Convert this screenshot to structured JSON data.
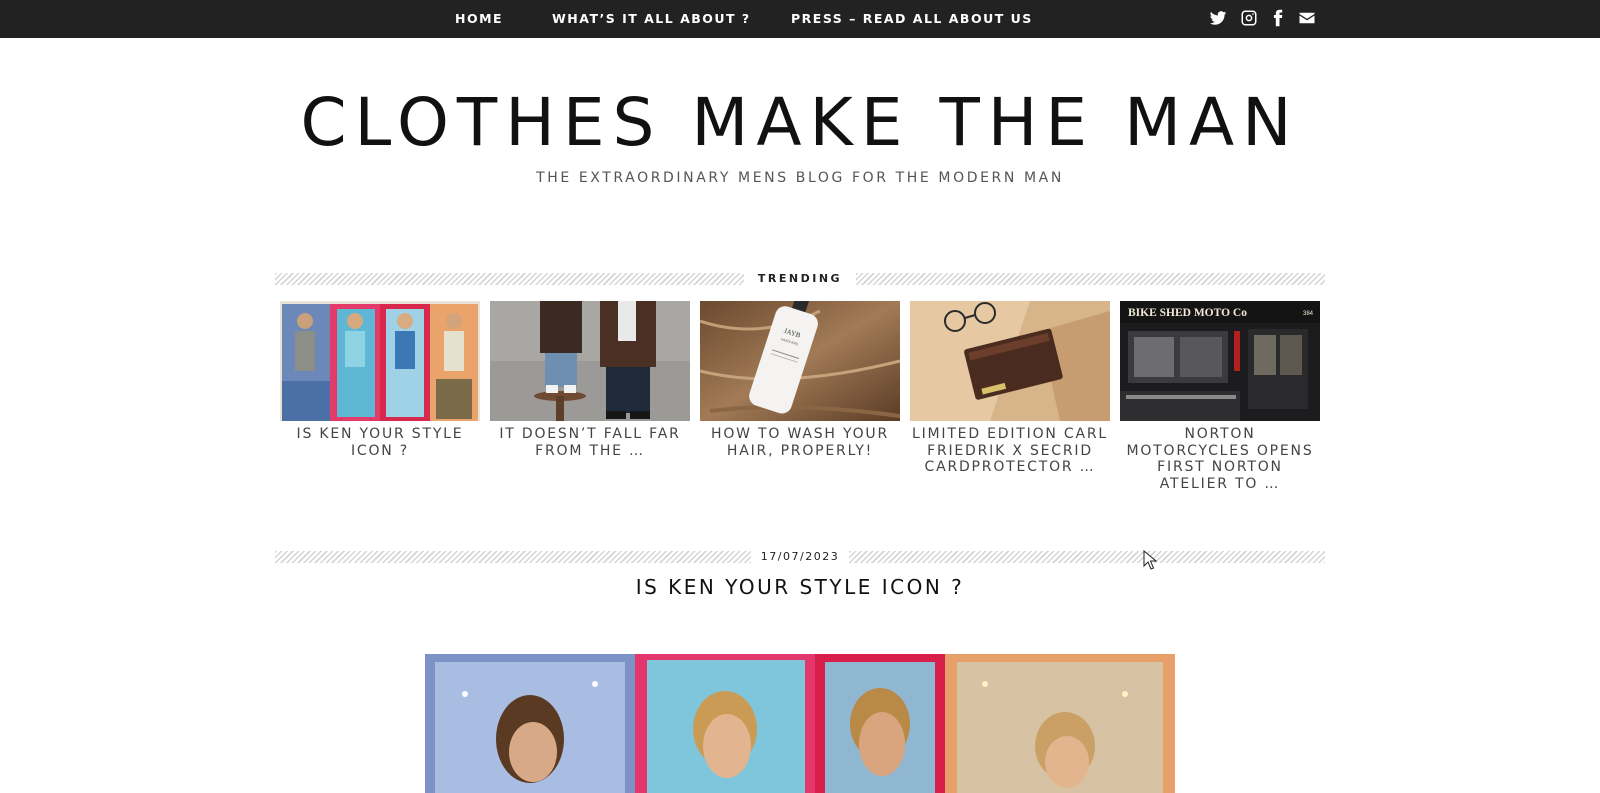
{
  "nav": {
    "items": [
      {
        "label": "HOME"
      },
      {
        "label": "WHAT’S IT ALL ABOUT ?"
      },
      {
        "label": "PRESS – READ ALL ABOUT US"
      }
    ],
    "social_icons": [
      "twitter-icon",
      "instagram-icon",
      "facebook-icon",
      "envelope-icon"
    ]
  },
  "header": {
    "title": "CLOTHES MAKE THE MAN",
    "tagline": "THE EXTRAORDINARY MENS BLOG FOR THE MODERN MAN"
  },
  "trending": {
    "heading": "TRENDING",
    "posts": [
      {
        "title": "IS KEN YOUR STYLE ICON ?"
      },
      {
        "title": "IT DOESN’T FALL FAR FROM THE …"
      },
      {
        "title": "HOW TO WASH YOUR HAIR, PROPERLY!"
      },
      {
        "title": "LIMITED EDITION CARL FRIEDRIK X SECRID CARDPROTECTOR …"
      },
      {
        "title": "NORTON MOTORCYCLES OPENS FIRST NORTON ATELIER TO …"
      }
    ],
    "thumb_text": {
      "bottle_brand": "JAYB",
      "bottle_sub": "HAIRCARE",
      "shop_sign": "BIKE SHED MOTO Co",
      "shop_number": "384"
    }
  },
  "post": {
    "date": "17/07/2023",
    "title": "IS KEN YOUR STYLE ICON ?"
  },
  "colors": {
    "nav_bg": "#222222",
    "text_dark": "#111111",
    "text_muted": "#555555"
  }
}
